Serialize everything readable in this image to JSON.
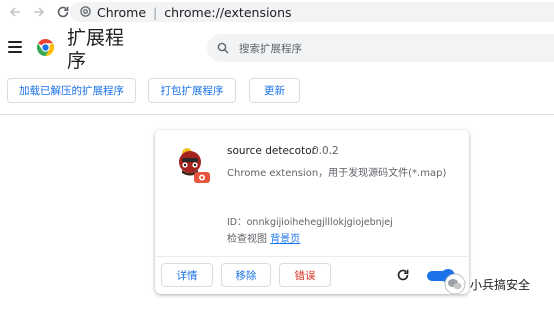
{
  "browser": {
    "site_chip": "Chrome",
    "url": "chrome://extensions"
  },
  "header": {
    "title": "扩展程序",
    "search_placeholder": "搜索扩展程序"
  },
  "actions": {
    "load_unpacked": "加载已解压的扩展程序",
    "pack": "打包扩展程序",
    "update": "更新"
  },
  "extension": {
    "name": "source detecotor",
    "version": "0.0.2",
    "description": "Chrome extension，用于发现源码文件(*.map)",
    "id_line": "ID：onnkgijioihehegjlllokjgiojebnjej",
    "inspect_label": "检查视图",
    "background_link": "背景页",
    "details_label": "详情",
    "remove_label": "移除",
    "errors_label": "错误",
    "enabled": true
  },
  "watermark": {
    "text": "小兵搞安全"
  },
  "colors": {
    "accent": "#1a73e8",
    "error": "#d93025",
    "toolbar_bg": "#f1f3f4"
  }
}
